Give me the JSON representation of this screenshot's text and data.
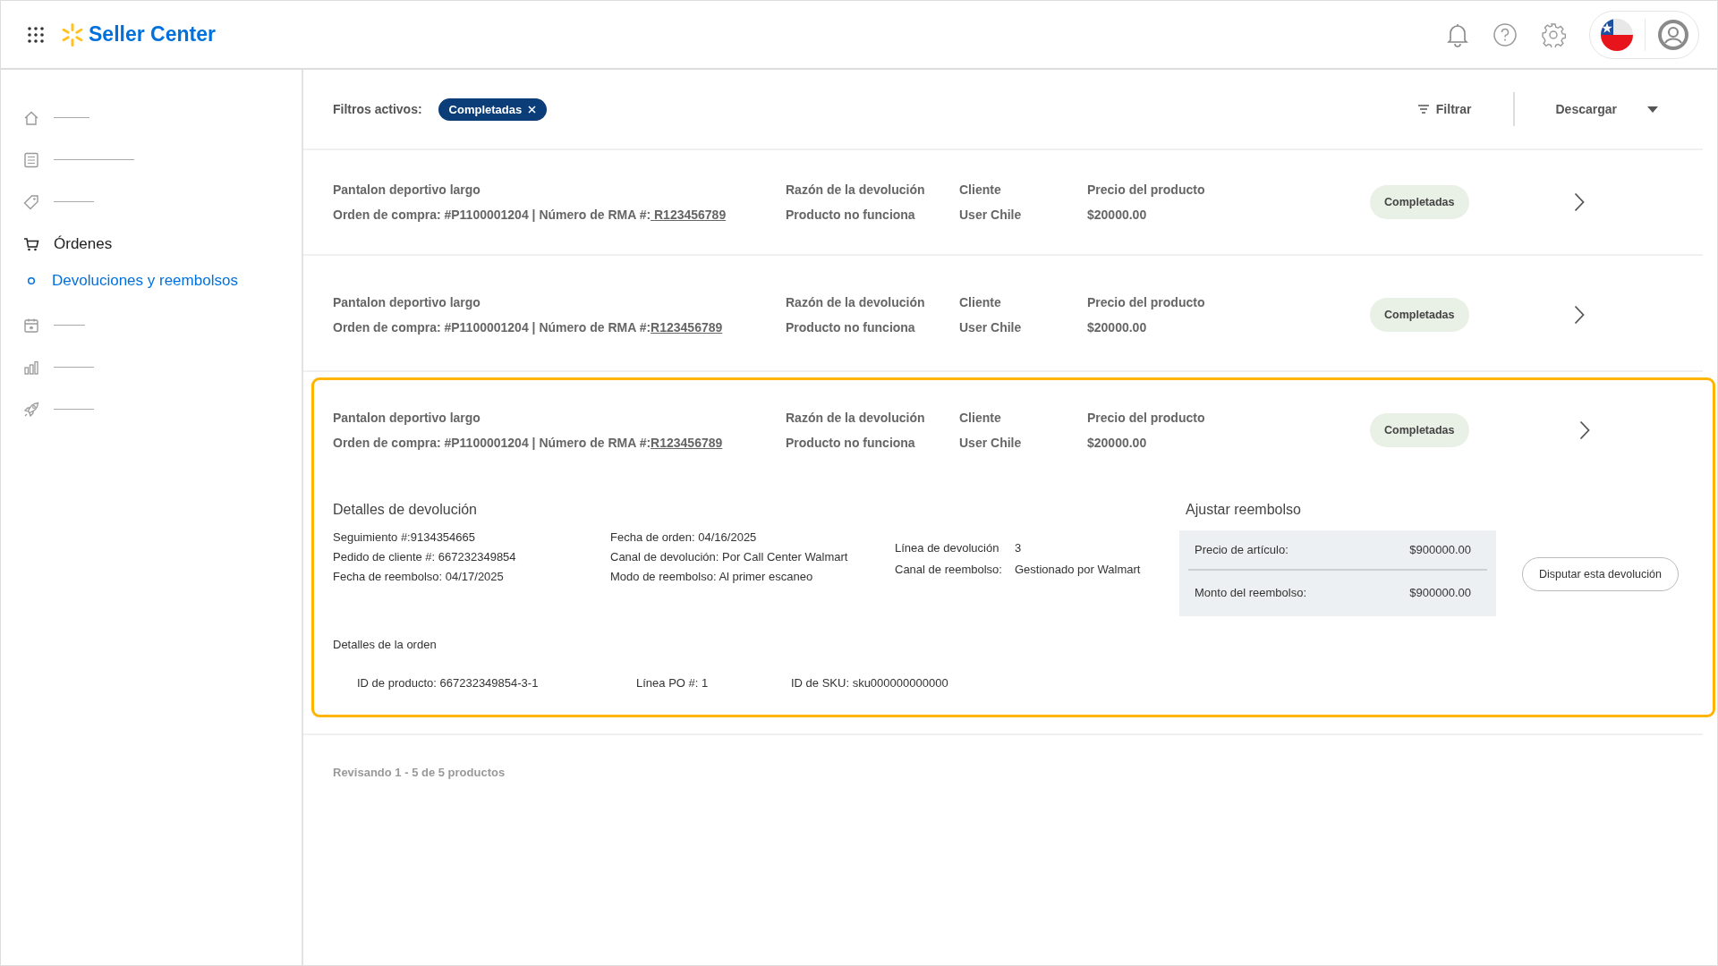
{
  "header": {
    "logo": "Seller Center"
  },
  "sidebar": {
    "items": [
      {
        "kind": "placeholder"
      },
      {
        "kind": "placeholder"
      },
      {
        "kind": "placeholder"
      },
      {
        "kind": "section",
        "label": "Órdenes",
        "expanded": true,
        "children": [
          {
            "label": "Devoluciones y reembolsos",
            "selected": true
          }
        ]
      },
      {
        "kind": "placeholder"
      },
      {
        "kind": "placeholder"
      },
      {
        "kind": "placeholder"
      }
    ]
  },
  "filters": {
    "label": "Filtros activos:",
    "chips": [
      {
        "label": "Completadas"
      }
    ],
    "filter_button": "Filtrar",
    "download": "Descargar"
  },
  "returns": [
    {
      "product": "Pantalon deportivo largo",
      "order_text": "Orden de compra: #P1100001204 | Número de RMA #:",
      "rma": " R123456789",
      "reason_label": "Razón de la devolución",
      "reason": "Producto no funciona",
      "customer_label": "Cliente",
      "customer": "User Chile",
      "price_label": "Precio del producto",
      "price": "$20000.00",
      "status": "Completadas",
      "expanded": false
    },
    {
      "product": "Pantalon deportivo largo",
      "order_text": "Orden de compra: #P1100001204 | Número de RMA #:",
      "rma": "R123456789",
      "reason_label": "Razón de la devolución",
      "reason": "Producto no funciona",
      "customer_label": "Cliente",
      "customer": "User Chile",
      "price_label": "Precio del producto",
      "price": "$20000.00",
      "status": "Completadas",
      "expanded": false
    },
    {
      "product": "Pantalon deportivo largo",
      "order_text": "Orden de compra: #P1100001204 | Número de RMA #:",
      "rma": "R123456789",
      "reason_label": "Razón de la devolución",
      "reason": "Producto no funciona",
      "customer_label": "Cliente",
      "customer": "User Chile",
      "price_label": "Precio del producto",
      "price": "$20000.00",
      "status": "Completadas",
      "expanded": true,
      "details": {
        "title": "Detalles de devolución",
        "col1": [
          "Seguimiento #:9134354665",
          "Pedido de cliente #: 667232349854",
          "Fecha de reembolso: 04/17/2025"
        ],
        "col2": [
          "Fecha de orden: 04/16/2025",
          "Canal de devolución: Por Call Center Walmart",
          "Modo de reembolso: Al primer escaneo"
        ],
        "pairs": [
          {
            "label": "Línea de devolución",
            "value": "3"
          },
          {
            "label": "Canal de reembolso:",
            "value": "Gestionado por Walmart"
          }
        ],
        "refund": {
          "title": "Ajustar reembolso",
          "rows": [
            {
              "label": "Precio de artículo:",
              "value": "$900000.00"
            },
            {
              "label": "Monto del reembolso:",
              "value": "$900000.00"
            }
          ]
        },
        "dispute": "Disputar esta devolución",
        "order_title": "Detalles de la orden",
        "order_items": [
          "ID de producto: 667232349854-3-1",
          "Línea PO #: 1",
          "ID de SKU: sku000000000000"
        ]
      }
    }
  ],
  "footer": "Revisando 1 - 5 de 5 productos"
}
